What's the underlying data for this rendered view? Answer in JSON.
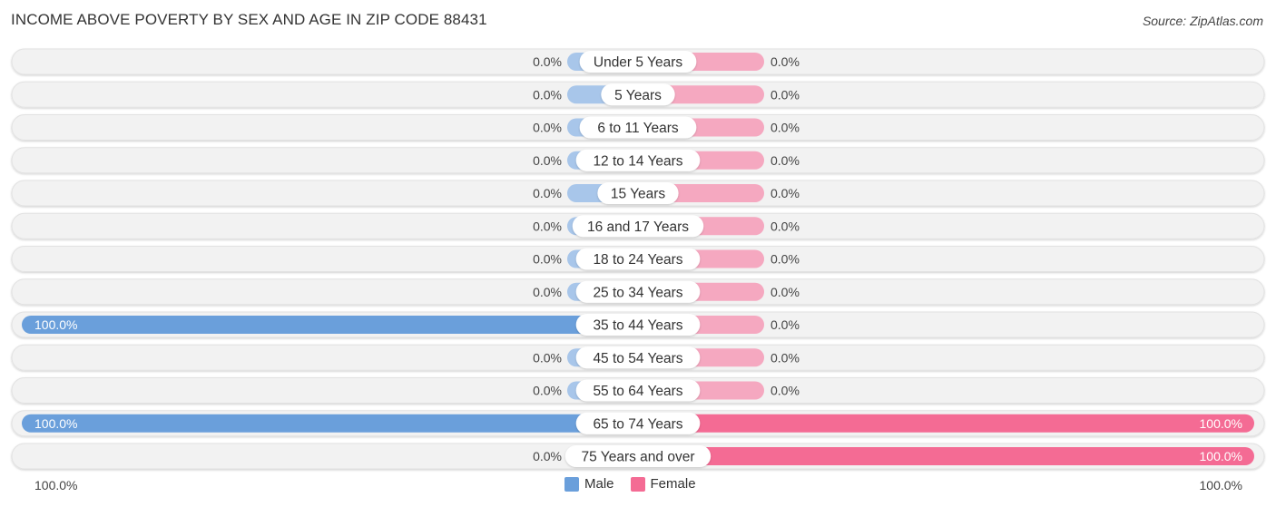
{
  "header": {
    "title": "INCOME ABOVE POVERTY BY SEX AND AGE IN ZIP CODE 88431",
    "source": "Source: ZipAtlas.com"
  },
  "colors": {
    "male_full": "#6a9fdb",
    "male_light": "#a8c6ea",
    "female_full": "#f46b94",
    "female_light": "#f5a8c0",
    "track": "#f2f2f2"
  },
  "chart_data": {
    "type": "bar",
    "orientation": "horizontal-diverging",
    "title": "INCOME ABOVE POVERTY BY SEX AND AGE IN ZIP CODE 88431",
    "categories": [
      "Under 5 Years",
      "5 Years",
      "6 to 11 Years",
      "12 to 14 Years",
      "15 Years",
      "16 and 17 Years",
      "18 to 24 Years",
      "25 to 34 Years",
      "35 to 44 Years",
      "45 to 54 Years",
      "55 to 64 Years",
      "65 to 74 Years",
      "75 Years and over"
    ],
    "series": [
      {
        "name": "Male",
        "values": [
          0,
          0,
          0,
          0,
          0,
          0,
          0,
          0,
          100,
          0,
          0,
          100,
          0
        ]
      },
      {
        "name": "Female",
        "values": [
          0,
          0,
          0,
          0,
          0,
          0,
          0,
          0,
          0,
          0,
          0,
          100,
          100
        ]
      }
    ],
    "value_labels": {
      "male": [
        "0.0%",
        "0.0%",
        "0.0%",
        "0.0%",
        "0.0%",
        "0.0%",
        "0.0%",
        "0.0%",
        "100.0%",
        "0.0%",
        "0.0%",
        "100.0%",
        "0.0%"
      ],
      "female": [
        "0.0%",
        "0.0%",
        "0.0%",
        "0.0%",
        "0.0%",
        "0.0%",
        "0.0%",
        "0.0%",
        "0.0%",
        "0.0%",
        "0.0%",
        "100.0%",
        "100.0%"
      ]
    },
    "xlim": [
      -100,
      100
    ],
    "axis_labels": {
      "left": "100.0%",
      "right": "100.0%"
    },
    "legend": {
      "position": "bottom-center",
      "entries": [
        "Male",
        "Female"
      ]
    }
  }
}
